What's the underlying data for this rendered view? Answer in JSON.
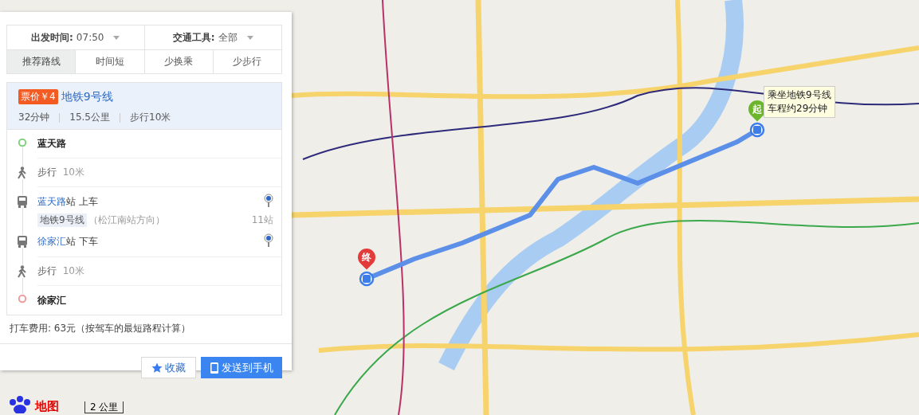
{
  "panel": {
    "filters": [
      {
        "label": "出发时间:",
        "value": "07:50"
      },
      {
        "label": "交通工具:",
        "value": "全部"
      }
    ],
    "tabs": [
      {
        "label": "推荐路线",
        "selected": true
      },
      {
        "label": "时间短",
        "selected": false
      },
      {
        "label": "少换乘",
        "selected": false
      },
      {
        "label": "少步行",
        "selected": false
      }
    ],
    "route": {
      "price": "票价￥4",
      "line": "地铁9号线",
      "stats": [
        "32分钟",
        "15.5公里",
        "步行10米"
      ],
      "steps": [
        {
          "kind": "origin",
          "name": "蓝天路"
        },
        {
          "kind": "walk",
          "text": "步行",
          "distance": "10米"
        },
        {
          "kind": "board",
          "station": "蓝天路",
          "rest": "站  上车",
          "line": "地铁9号线",
          "direction": "（松江南站方向）",
          "stops": "11站"
        },
        {
          "kind": "alight",
          "station": "徐家汇",
          "rest": "站 下车"
        },
        {
          "kind": "walk",
          "text": "步行",
          "distance": "10米"
        },
        {
          "kind": "destination",
          "name": "徐家汇"
        }
      ]
    },
    "taxi": "打车费用: 63元（按驾车的最短路程计算）",
    "buttons": [
      {
        "kind": "favorite",
        "label": "收藏"
      },
      {
        "kind": "send",
        "label": "发送到手机"
      }
    ]
  },
  "map": {
    "start_marker": "起",
    "end_marker": "终",
    "tooltip": [
      "乘坐地铁9号线",
      "车程约29分钟"
    ],
    "scale": "2 公里",
    "logo": "地图"
  }
}
